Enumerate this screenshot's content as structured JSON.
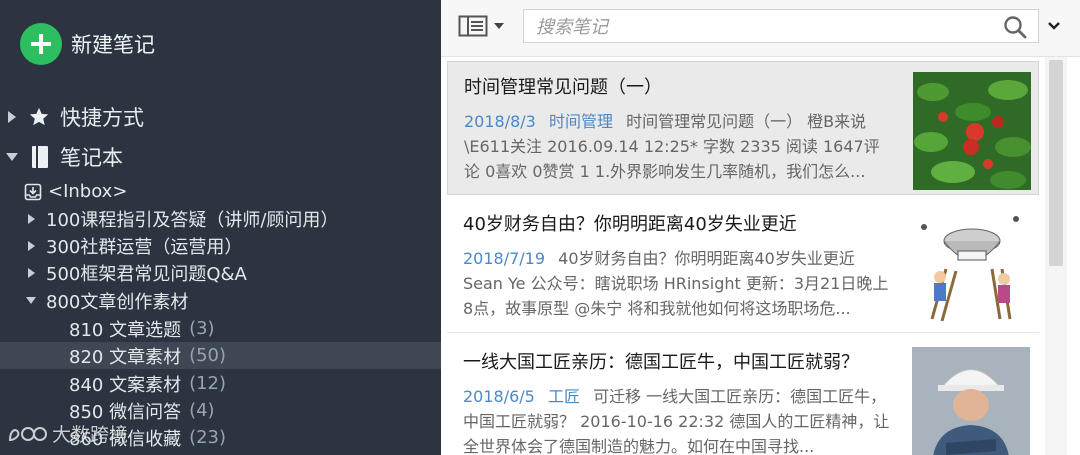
{
  "sidebar": {
    "new_note": "新建笔记",
    "shortcuts": "快捷方式",
    "notebooks": "笔记本",
    "items": [
      {
        "label": "<Inbox>",
        "count": ""
      },
      {
        "label": "100课程指引及答疑（讲师/顾问用）",
        "count": ""
      },
      {
        "label": "300社群运营（运营用）",
        "count": ""
      },
      {
        "label": "500框架君常见问题Q&A",
        "count": ""
      },
      {
        "label": "800文章创作素材",
        "count": ""
      },
      {
        "label": "810 文章选题",
        "count": "(3)"
      },
      {
        "label": "820 文章素材",
        "count": "(50)"
      },
      {
        "label": "840 文案素材",
        "count": "(12)"
      },
      {
        "label": "850 微信问答",
        "count": "(4)"
      },
      {
        "label": "860 微信收藏",
        "count": "(23)"
      }
    ],
    "watermark": "大数跨境"
  },
  "toolbar": {
    "search_placeholder": "搜索笔记"
  },
  "notes": [
    {
      "title": "时间管理常见问题（一）",
      "date": "2018/8/3",
      "tag": "时间管理",
      "snippet": "时间管理常见问题（一） 橙B来说\\E611关注 2016.09.14 12:25* 字数 2335 阅读 1647评论 0喜欢 0赞赏 1 1.外界影响发生几率随机，我们怎么..."
    },
    {
      "title": "40岁财务自由？你明明距离40岁失业更近",
      "date": "2018/7/19",
      "tag": "",
      "snippet": "40岁财务自由？你明明距离40岁失业更近 Sean Ye 公众号：瞎说职场 HRinsight 更新：3月21日晚上8点，故事原型 @朱宁 将和我就他如何将这场职场危..."
    },
    {
      "title": "一线大国工匠亲历：德国工匠牛，中国工匠就弱？",
      "date": "2018/6/5",
      "tag": "工匠",
      "snippet": "可迁移 一线大国工匠亲历：德国工匠牛，中国工匠就弱？ 2016-10-16 22:32 德国人的工匠精神，让全世界体会了德国制造的魅力。如何在中国寻找..."
    }
  ],
  "colors": {
    "sidebar_bg": "#2b3440",
    "accent_green": "#2dbe60",
    "link_blue": "#4a88c7"
  }
}
